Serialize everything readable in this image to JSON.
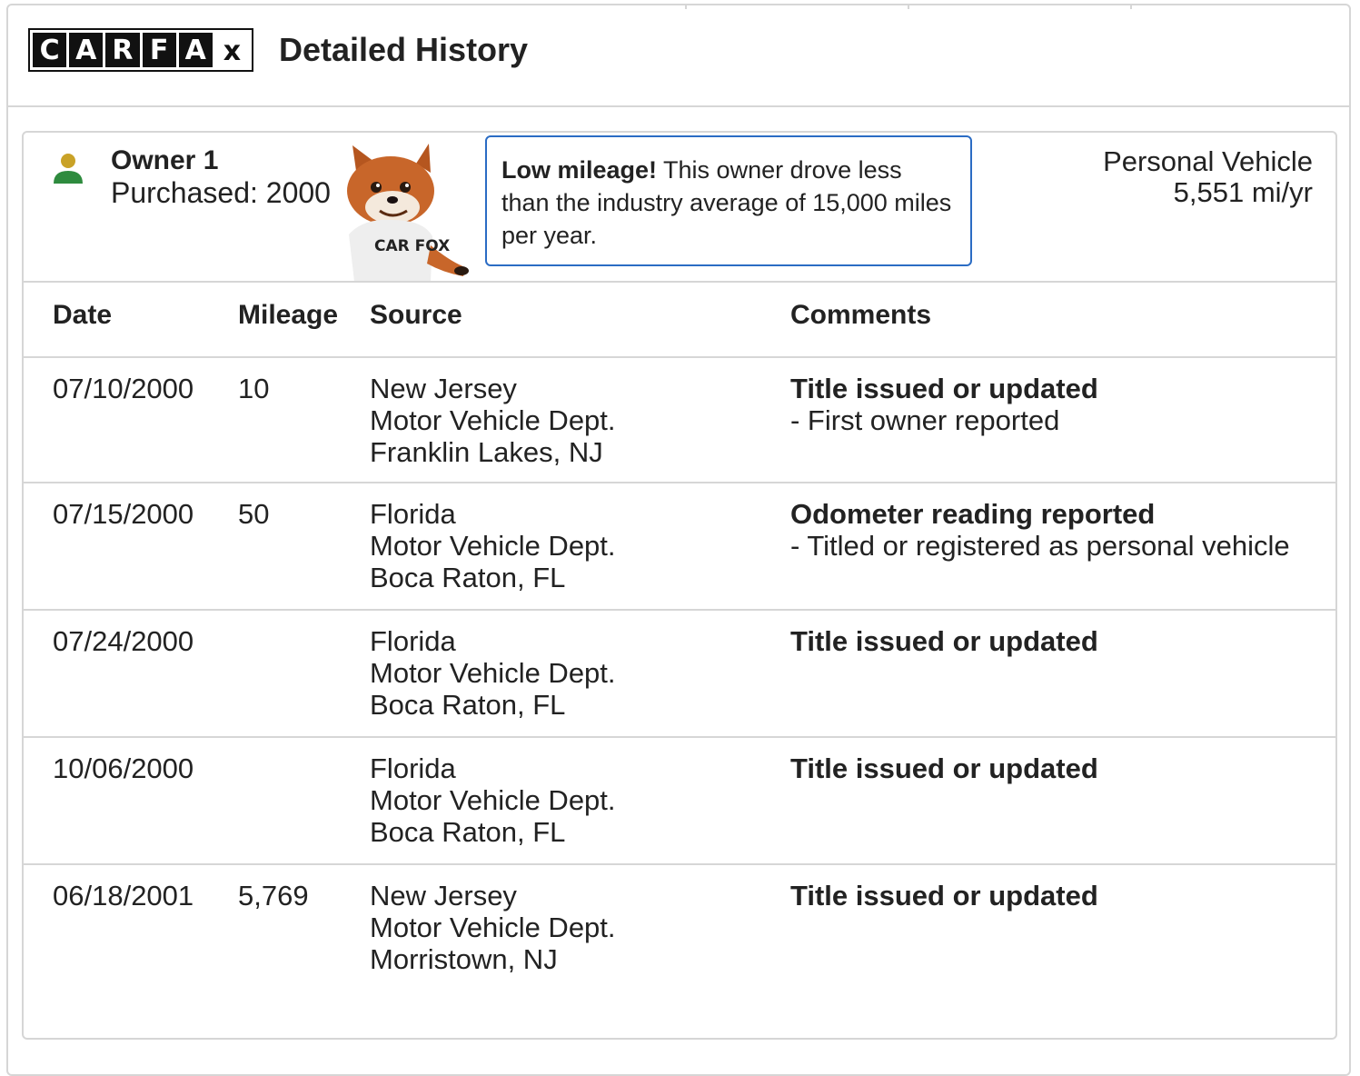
{
  "header": {
    "logo_letters": [
      "C",
      "A",
      "R",
      "F",
      "A",
      "x"
    ],
    "title": "Detailed History"
  },
  "owner": {
    "label": "Owner 1",
    "purchased": "Purchased: 2000",
    "callout_bold": "Low mileage!",
    "callout_text": " This owner drove less than the industry average of 15,000 miles per year.",
    "vehicle_type": "Personal Vehicle",
    "vehicle_miles": "5,551 mi/yr",
    "mascot_shirt_text": "CAR FOX"
  },
  "table": {
    "headers": {
      "date": "Date",
      "mileage": "Mileage",
      "source": "Source",
      "comments": "Comments"
    },
    "rows": [
      {
        "date": "07/10/2000",
        "mileage": "10",
        "source": [
          "New Jersey",
          "Motor Vehicle Dept.",
          "Franklin Lakes, NJ"
        ],
        "comment_title": "Title issued or updated",
        "comment_detail": "- First owner reported"
      },
      {
        "date": "07/15/2000",
        "mileage": "50",
        "source": [
          "Florida",
          "Motor Vehicle Dept.",
          "Boca Raton, FL"
        ],
        "comment_title": "Odometer reading reported",
        "comment_detail": "- Titled or registered as personal vehicle"
      },
      {
        "date": "07/24/2000",
        "mileage": "",
        "source": [
          "Florida",
          "Motor Vehicle Dept.",
          "Boca Raton, FL"
        ],
        "comment_title": "Title issued or updated",
        "comment_detail": ""
      },
      {
        "date": "10/06/2000",
        "mileage": "",
        "source": [
          "Florida",
          "Motor Vehicle Dept.",
          "Boca Raton, FL"
        ],
        "comment_title": "Title issued or updated",
        "comment_detail": ""
      },
      {
        "date": "06/18/2001",
        "mileage": "5,769",
        "source": [
          "New Jersey",
          "Motor Vehicle Dept.",
          "Morristown, NJ"
        ],
        "comment_title": "Title issued or updated",
        "comment_detail": ""
      }
    ]
  },
  "colors": {
    "callout_border": "#2b6cc4",
    "person_head": "#c9a227",
    "person_body": "#2e8b3e",
    "border": "#d6d6d6"
  },
  "icons": {
    "owner": "person-icon",
    "mascot": "fox-mascot-icon"
  }
}
